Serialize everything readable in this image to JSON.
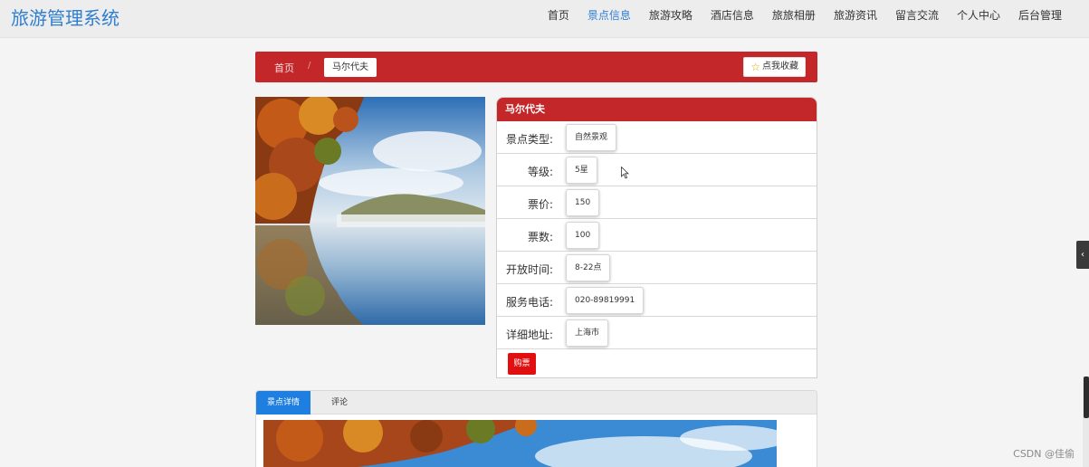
{
  "site": {
    "brand": "旅游管理系统"
  },
  "nav": [
    {
      "label": "首页",
      "active": false
    },
    {
      "label": "景点信息",
      "active": true
    },
    {
      "label": "旅游攻略",
      "active": false
    },
    {
      "label": "酒店信息",
      "active": false
    },
    {
      "label": "旅旅相册",
      "active": false
    },
    {
      "label": "旅游资讯",
      "active": false
    },
    {
      "label": "留言交流",
      "active": false
    },
    {
      "label": "个人中心",
      "active": false
    },
    {
      "label": "后台管理",
      "active": false
    }
  ],
  "breadcrumb": {
    "home": "首页",
    "separator": "/",
    "current": "马尔代夫"
  },
  "favorite_button": "点我收藏",
  "spot": {
    "name": "马尔代夫",
    "fields": [
      {
        "label": "景点类型:",
        "value": "自然景观"
      },
      {
        "label": "等级:",
        "value": "5星"
      },
      {
        "label": "票价:",
        "value": "150"
      },
      {
        "label": "票数:",
        "value": "100"
      },
      {
        "label": "开放时间:",
        "value": "8-22点"
      },
      {
        "label": "服务电话:",
        "value": "020-89819991"
      },
      {
        "label": "详细地址:",
        "value": "上海市"
      }
    ],
    "buy_button": "购票"
  },
  "tabs": [
    {
      "label": "景点详情",
      "active": true
    },
    {
      "label": "评论",
      "active": false
    }
  ],
  "watermark": "CSDN @佳偷",
  "colors": {
    "brand": "#2f7fd1",
    "accent_red": "#c4272a",
    "buy_red": "#e01010",
    "tab_blue": "#1e7fe0"
  },
  "icons": {
    "favorite": "star-icon",
    "side_handle": "chevron-left-icon",
    "cursor": "mouse-pointer-icon"
  }
}
